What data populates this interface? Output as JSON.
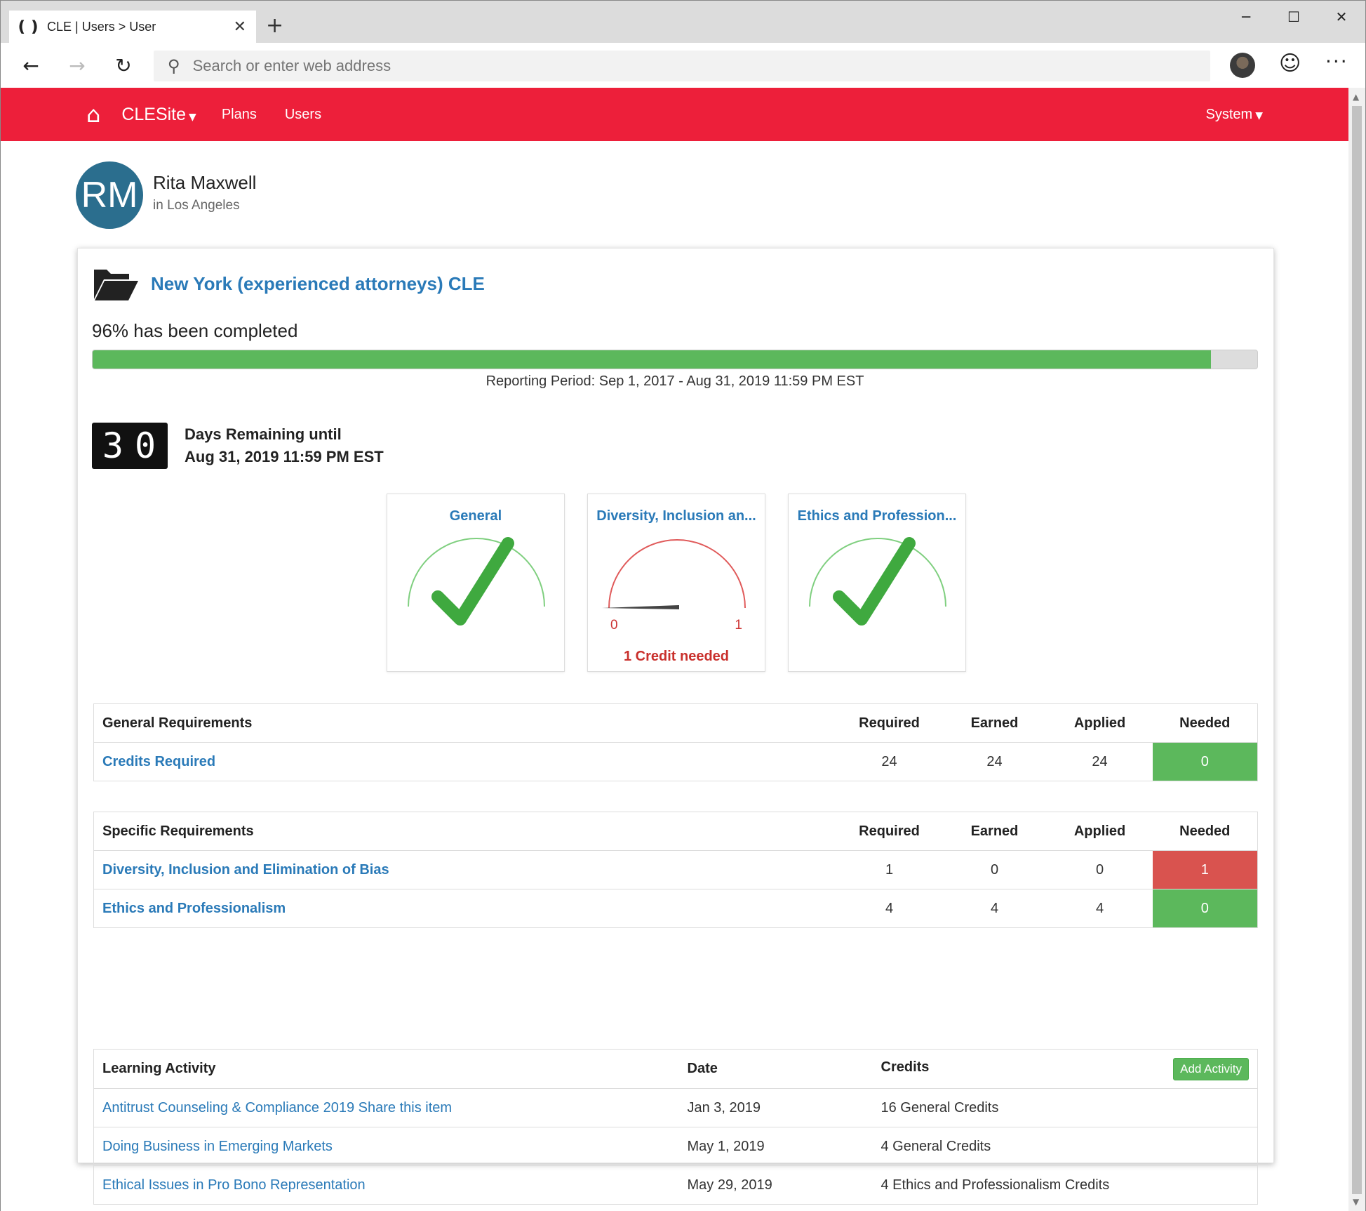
{
  "browser": {
    "tab_title": "CLE | Users > User",
    "address_placeholder": "Search or enter web address"
  },
  "nav": {
    "brand": "CLESite",
    "links": [
      "Plans",
      "Users"
    ],
    "system": "System"
  },
  "user": {
    "initials": "RM",
    "name": "Rita Maxwell",
    "location": "in Los Angeles"
  },
  "plan": {
    "title": "New York (experienced attorneys) CLE",
    "completion_text": "96% has been completed",
    "progress_percent": 96,
    "reporting_period": "Reporting Period: Sep 1, 2017 - Aug 31, 2019 11:59 PM EST",
    "days_remaining": "30",
    "days_label_1": "Days Remaining until",
    "days_label_2": "Aug 31, 2019 11:59 PM EST"
  },
  "gauges": [
    {
      "title": "General",
      "status": "complete"
    },
    {
      "title": "Diversity, Inclusion an...",
      "status": "incomplete",
      "min": "0",
      "max": "1",
      "value": 0,
      "message": "1 Credit needed"
    },
    {
      "title": "Ethics and Profession...",
      "status": "complete"
    }
  ],
  "general_requirements": {
    "headers": [
      "General Requirements",
      "Required",
      "Earned",
      "Applied",
      "Needed"
    ],
    "rows": [
      {
        "name": "Credits Required",
        "required": "24",
        "earned": "24",
        "applied": "24",
        "needed": "0"
      }
    ]
  },
  "specific_requirements": {
    "headers": [
      "Specific Requirements",
      "Required",
      "Earned",
      "Applied",
      "Needed"
    ],
    "rows": [
      {
        "name": "Diversity, Inclusion and Elimination of Bias",
        "required": "1",
        "earned": "0",
        "applied": "0",
        "needed": "1"
      },
      {
        "name": "Ethics and Professionalism",
        "required": "4",
        "earned": "4",
        "applied": "4",
        "needed": "0"
      }
    ]
  },
  "learning_activity": {
    "headers": [
      "Learning Activity",
      "Date",
      "Credits"
    ],
    "add_button": "Add Activity",
    "rows": [
      {
        "name": "Antitrust Counseling & Compliance 2019 Share this item",
        "date": "Jan 3, 2019",
        "credits": "16 General Credits"
      },
      {
        "name": "Doing Business in Emerging Markets",
        "date": "May 1, 2019",
        "credits": "4 General Credits"
      },
      {
        "name": "Ethical Issues in Pro Bono Representation",
        "date": "May 29, 2019",
        "credits": "4 Ethics and Professionalism Credits"
      }
    ]
  },
  "colors": {
    "nav_red": "#ed1f3a",
    "link_blue": "#2a7ab8",
    "success_green": "#5cb85c",
    "danger_red": "#d9534f",
    "avatar_blue": "#2b6e8e"
  }
}
